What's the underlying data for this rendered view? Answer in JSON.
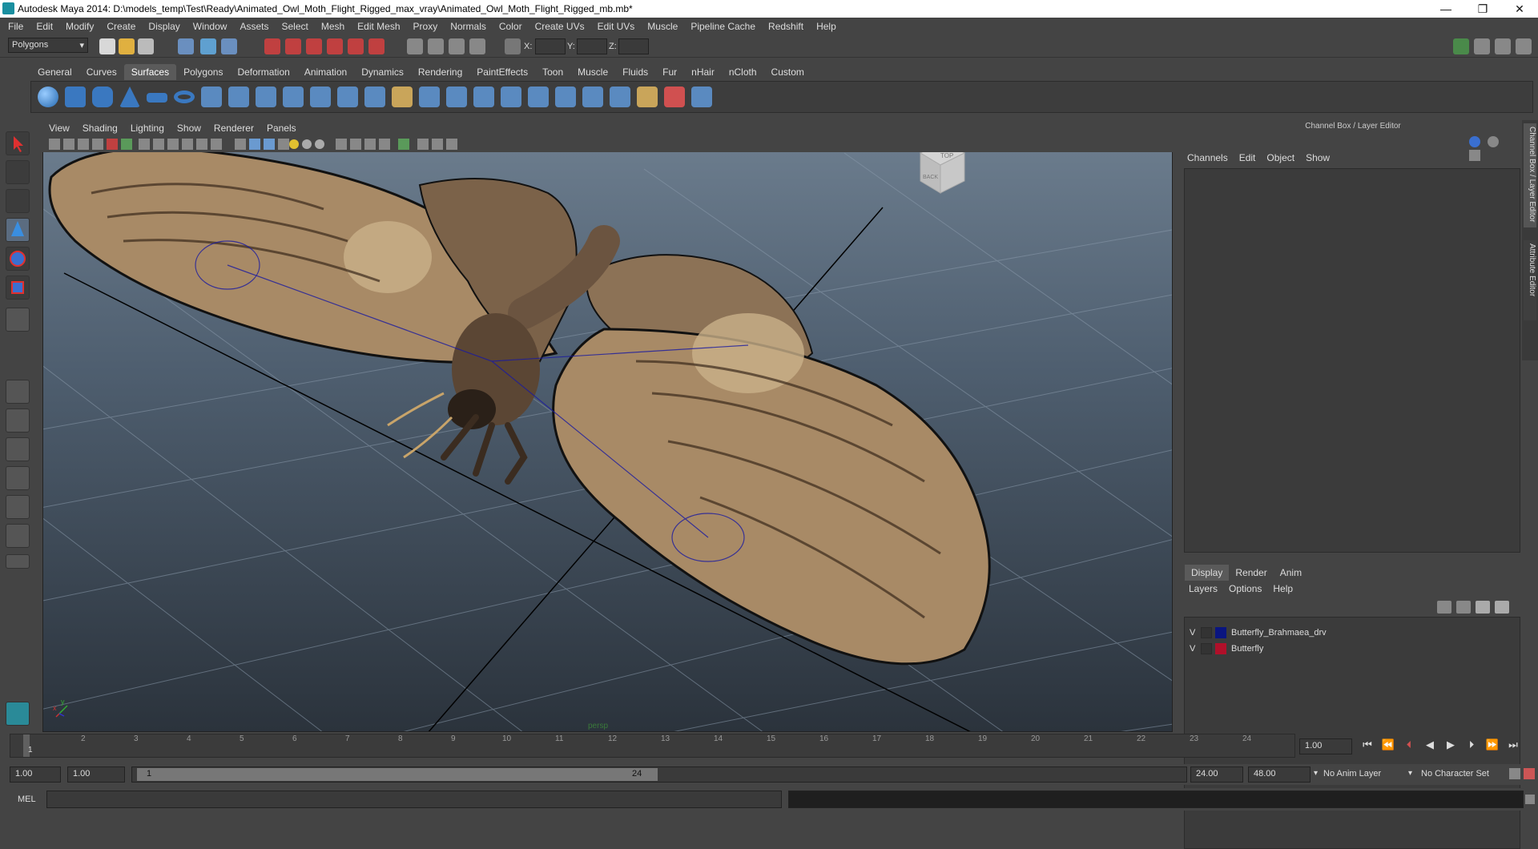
{
  "window": {
    "title": "Autodesk Maya 2014: D:\\models_temp\\Test\\Ready\\Animated_Owl_Moth_Flight_Rigged_max_vray\\Animated_Owl_Moth_Flight_Rigged_mb.mb*",
    "minimize": "—",
    "restore": "❐",
    "close": "✕"
  },
  "menubar": [
    "File",
    "Edit",
    "Modify",
    "Create",
    "Display",
    "Window",
    "Assets",
    "Select",
    "Mesh",
    "Edit Mesh",
    "Proxy",
    "Normals",
    "Color",
    "Create UVs",
    "Edit UVs",
    "Muscle",
    "Pipeline Cache",
    "Redshift",
    "Help"
  ],
  "statusline": {
    "mode": "Polygons",
    "x_label": "X:",
    "y_label": "Y:",
    "z_label": "Z:"
  },
  "shelf": {
    "tabs": [
      "General",
      "Curves",
      "Surfaces",
      "Polygons",
      "Deformation",
      "Animation",
      "Dynamics",
      "Rendering",
      "PaintEffects",
      "Toon",
      "Muscle",
      "Fluids",
      "Fur",
      "nHair",
      "nCloth",
      "Custom"
    ],
    "active": "Surfaces"
  },
  "viewport": {
    "menu": [
      "View",
      "Shading",
      "Lighting",
      "Show",
      "Renderer",
      "Panels"
    ],
    "viewcube_top": "TOP",
    "viewcube_back": "BACK",
    "camera_label": "persp",
    "axis_x": "x",
    "axis_y": "y"
  },
  "channel_box": {
    "header": "Channel Box / Layer Editor",
    "menu": [
      "Channels",
      "Edit",
      "Object",
      "Show"
    ],
    "side_tab1": "Channel Box / Layer Editor",
    "side_tab2": "Attribute Editor"
  },
  "layer_editor": {
    "tabs": [
      "Display",
      "Render",
      "Anim"
    ],
    "active": "Display",
    "menu": [
      "Layers",
      "Options",
      "Help"
    ],
    "layers": [
      {
        "visible": "V",
        "name": "Butterfly_Brahmaea_drv",
        "color": "#0a1580"
      },
      {
        "visible": "V",
        "name": "Butterfly",
        "color": "#b0102a"
      }
    ]
  },
  "timeline": {
    "ticks": [
      "1",
      "2",
      "3",
      "4",
      "5",
      "6",
      "7",
      "8",
      "9",
      "10",
      "11",
      "12",
      "13",
      "14",
      "15",
      "16",
      "17",
      "18",
      "19",
      "20",
      "21",
      "22",
      "23",
      "24"
    ],
    "current_frame": "1.00"
  },
  "range": {
    "start": "1.00",
    "playback_start": "1.00",
    "slider_start": "1",
    "slider_end": "24",
    "playback_end": "24.00",
    "end": "48.00",
    "anim_layer": "No Anim Layer",
    "char_set": "No Character Set"
  },
  "mel": {
    "label": "MEL"
  }
}
